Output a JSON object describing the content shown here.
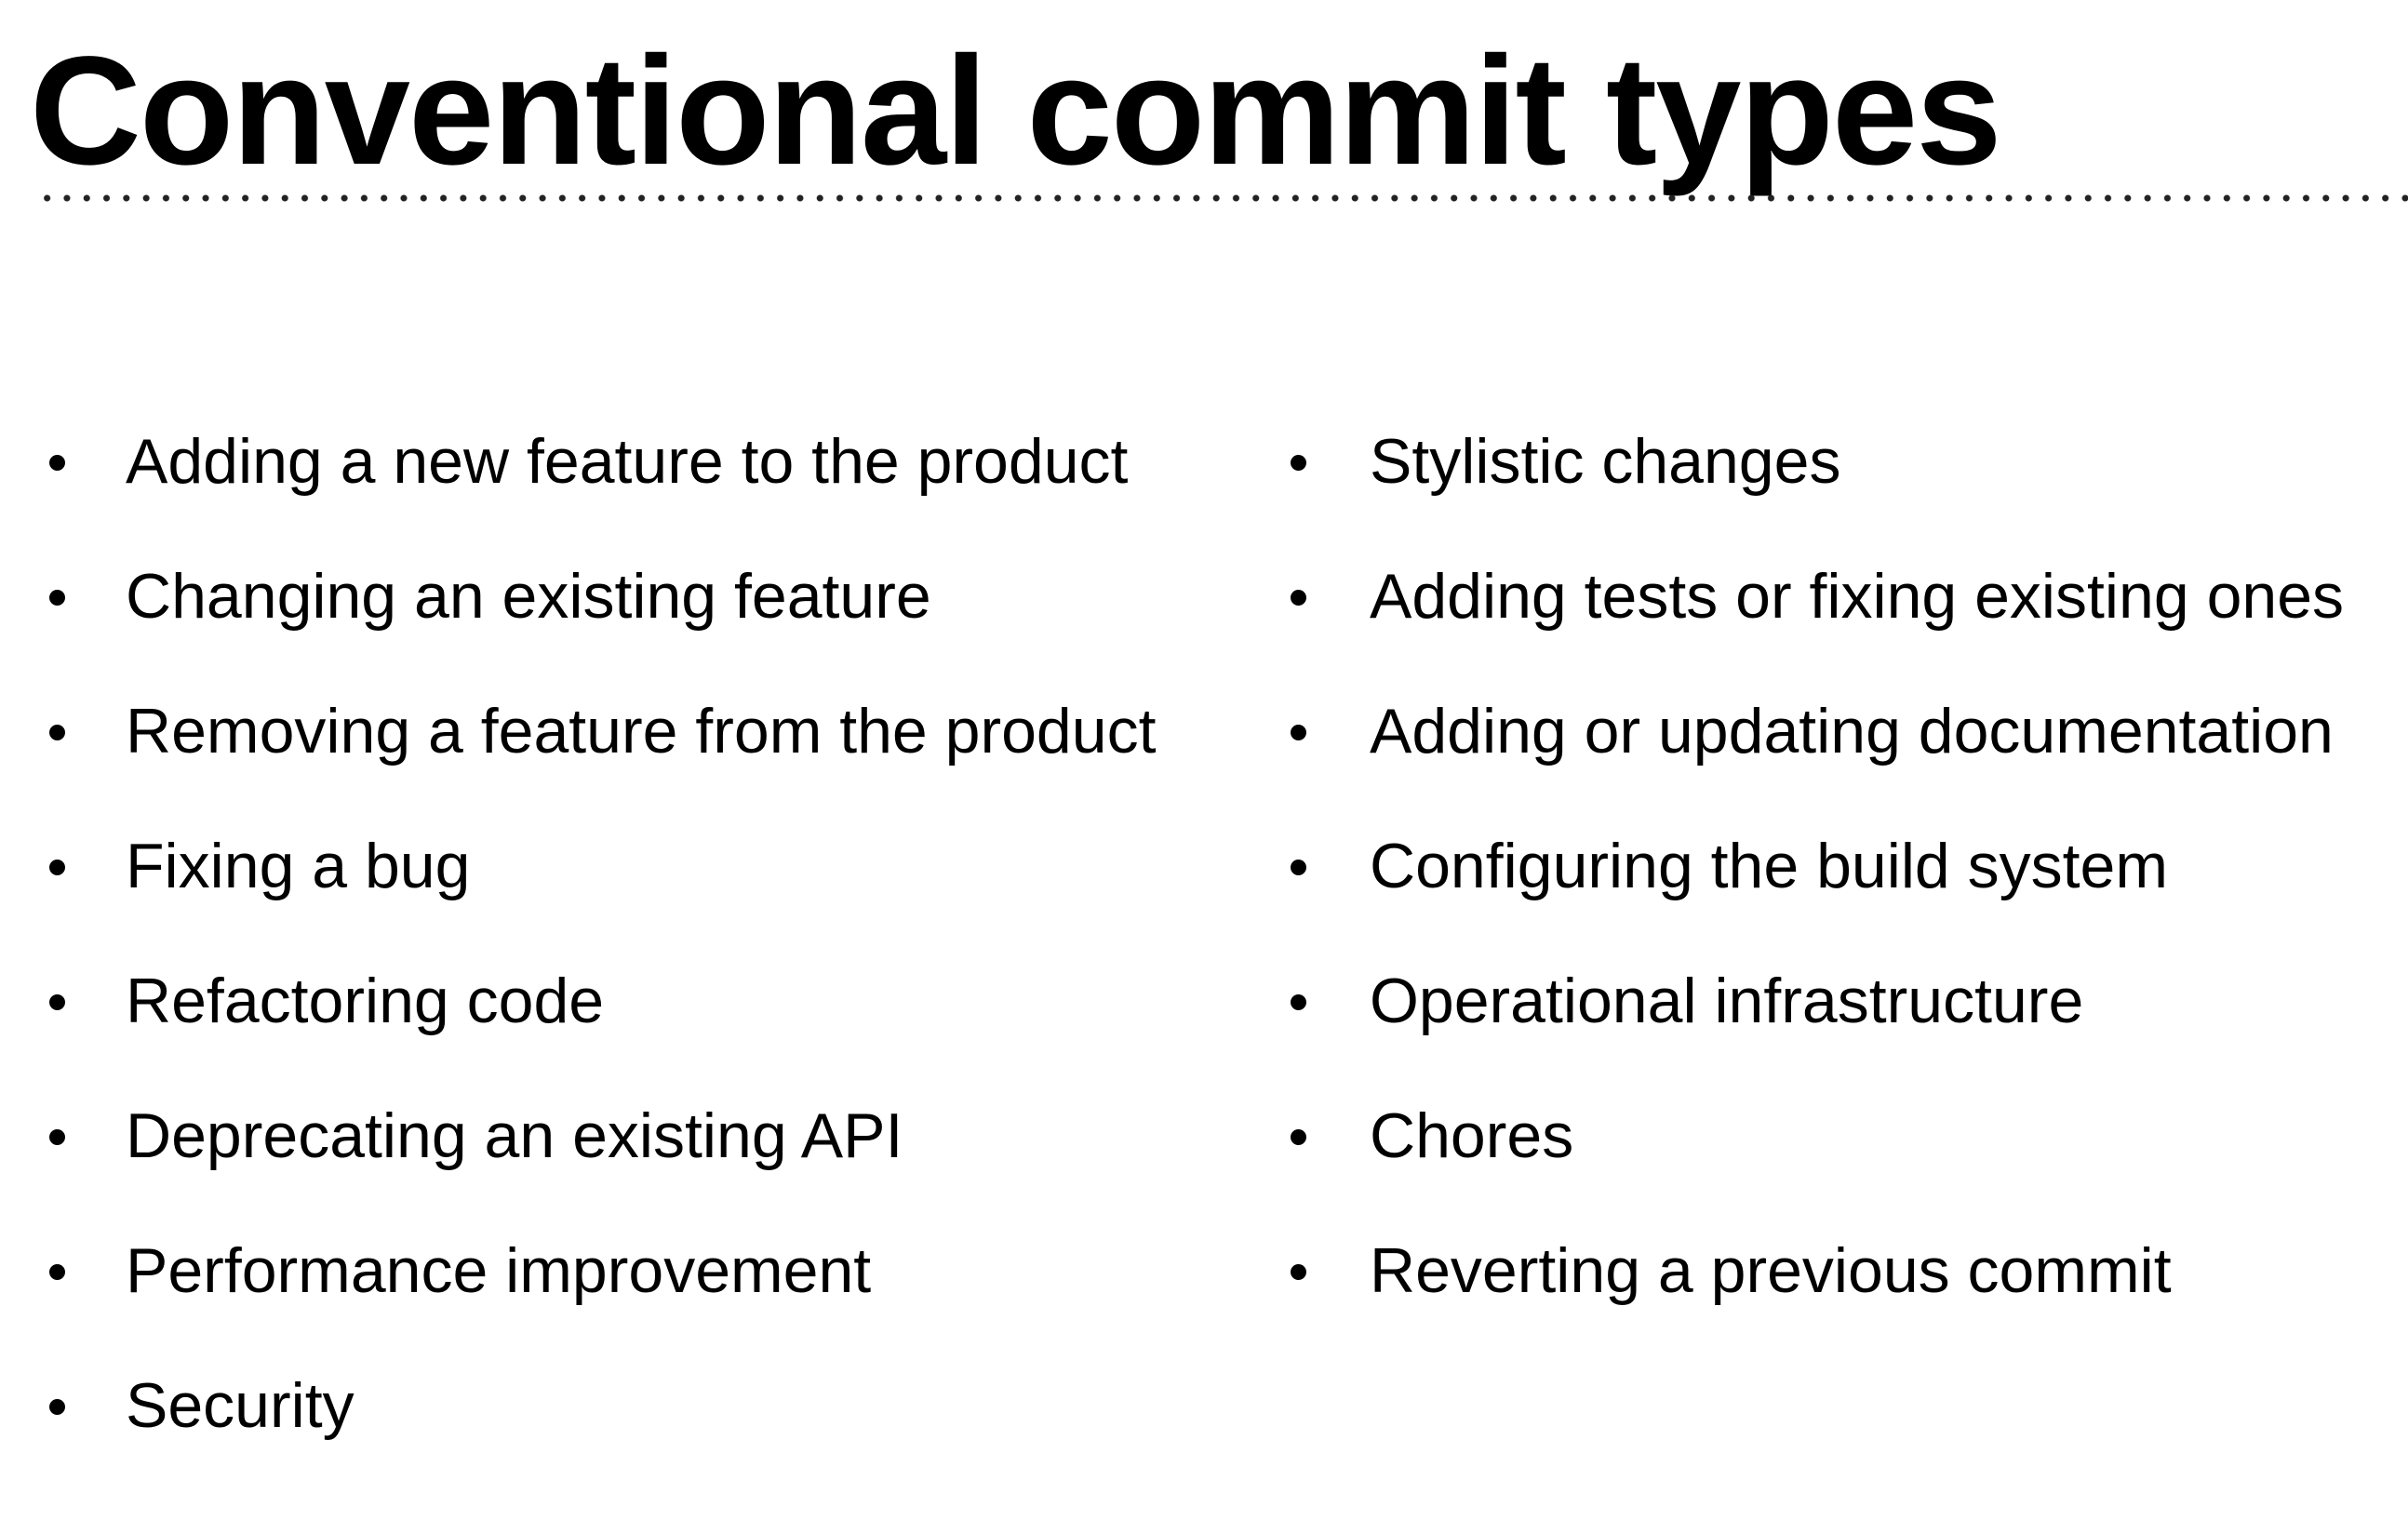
{
  "title": "Conventional commit types",
  "columns": {
    "left": [
      "Adding a new feature to the product",
      "Changing an existing feature",
      "Removing a feature from the product",
      "Fixing a bug",
      "Refactoring code",
      "Deprecating an existing API",
      "Performance improvement",
      "Security"
    ],
    "right": [
      "Stylistic changes",
      "Adding tests or fixing existing ones",
      "Adding or updating documentation",
      "Configuring the build system",
      "Operational infrastructure",
      "Chores",
      "Reverting a previous commit"
    ]
  }
}
